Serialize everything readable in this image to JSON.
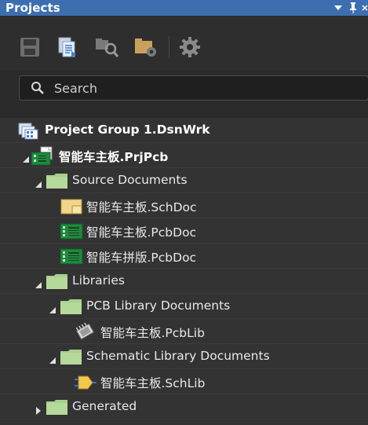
{
  "panel": {
    "title": "Projects"
  },
  "toolbar": {
    "buttons": [
      {
        "name": "save-icon"
      },
      {
        "name": "copy-documents-icon"
      },
      {
        "name": "find-icon"
      },
      {
        "name": "folder-settings-icon"
      },
      {
        "name": "gear-icon"
      }
    ]
  },
  "search": {
    "placeholder": "Search"
  },
  "tree": {
    "items": [
      {
        "label": "Project Group 1.DsnWrk",
        "icon": "project-group-icon",
        "expanded": true,
        "bold": true
      },
      {
        "label": "智能车主板.PrjPcb",
        "icon": "pcb-project-icon",
        "expanded": true,
        "bold": true
      },
      {
        "label": "Source Documents",
        "icon": "folder-icon",
        "expanded": true
      },
      {
        "label": "智能车主板.SchDoc",
        "icon": "schematic-doc-icon"
      },
      {
        "label": "智能车主板.PcbDoc",
        "icon": "pcb-doc-icon"
      },
      {
        "label": "智能车拼版.PcbDoc",
        "icon": "pcb-doc-icon"
      },
      {
        "label": "Libraries",
        "icon": "folder-icon",
        "expanded": true
      },
      {
        "label": "PCB Library Documents",
        "icon": "folder-icon",
        "expanded": true
      },
      {
        "label": "智能车主板.PcbLib",
        "icon": "pcb-library-icon"
      },
      {
        "label": "Schematic Library Documents",
        "icon": "folder-icon",
        "expanded": true
      },
      {
        "label": "智能车主板.SchLib",
        "icon": "schematic-library-icon"
      },
      {
        "label": "Generated",
        "icon": "folder-icon",
        "expanded": false
      }
    ]
  },
  "colors": {
    "title_bar": "#3d6fb0",
    "folder": "#a8d08d",
    "pcb_green": "#1e8a3e"
  }
}
